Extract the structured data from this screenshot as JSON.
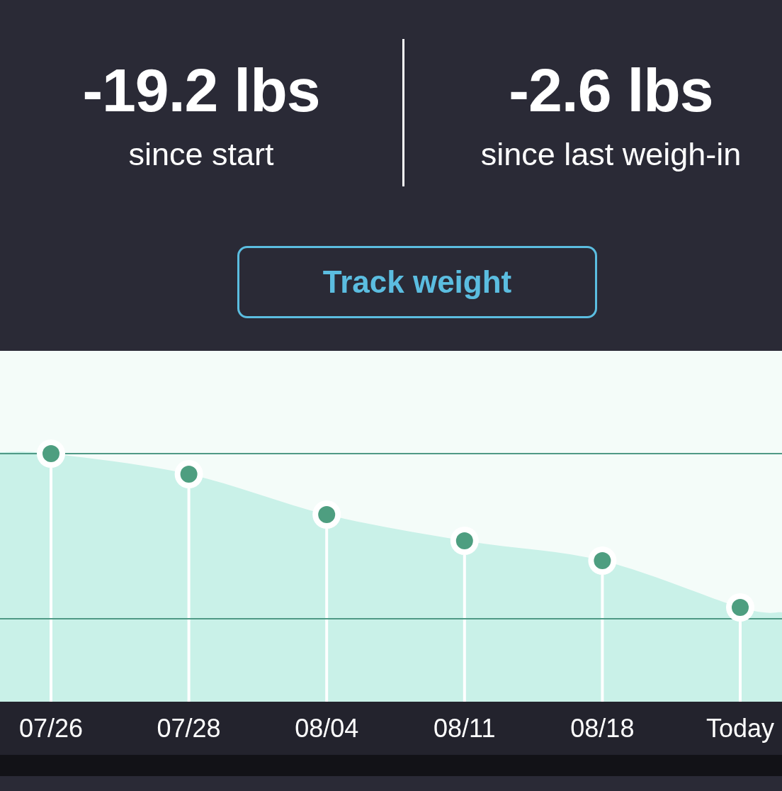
{
  "stats": [
    {
      "value": "-19.2 lbs",
      "caption": "since start"
    },
    {
      "value": "-2.6 lbs",
      "caption": "since last weigh-in"
    }
  ],
  "track_button": {
    "label": "Track weight"
  },
  "weight_chart": {
    "x_labels": [
      "07/26",
      "07/28",
      "08/04",
      "08/11",
      "08/18",
      "Today"
    ]
  }
}
